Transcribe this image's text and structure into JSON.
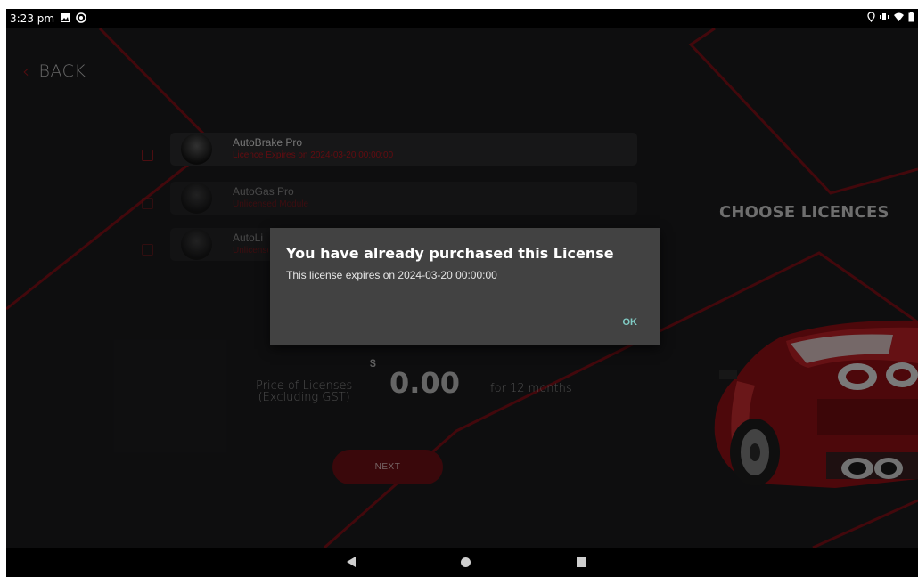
{
  "status_bar": {
    "time": "3:23 pm"
  },
  "header": {
    "back_label": "BACK",
    "title": "CHOOSE LICENCES"
  },
  "licenses": [
    {
      "name": "AutoBrake Pro",
      "status": "Licence Expires on 2024-03-20 00:00:00"
    },
    {
      "name": "AutoGas Pro",
      "status": "Unlicensed Module"
    },
    {
      "name": "AutoLi",
      "status": "Unlicensed Module"
    }
  ],
  "pricing": {
    "label_line1": "Price of Licenses",
    "label_line2": "(Excluding GST)",
    "currency": "$",
    "amount": "0.00",
    "period": "for 12 months"
  },
  "next_label": "NEXT",
  "dialog": {
    "title": "You have already purchased this License",
    "message": "This license expires on 2024-03-20 00:00:00",
    "ok_label": "OK"
  },
  "colors": {
    "accent": "#a3161d",
    "dialog_bg": "#424242",
    "ok": "#80cbc4"
  }
}
